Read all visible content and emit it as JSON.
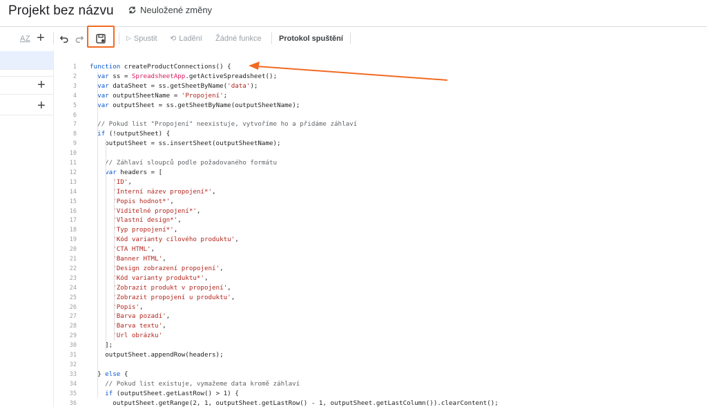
{
  "header": {
    "project_title": "Projekt bez názvu",
    "save_status": "Neuložené změny"
  },
  "toolbar": {
    "sort_label": "AZ",
    "run_label": "Spustit",
    "debug_label": "Ladění",
    "functions_label": "Žádné funkce",
    "execution_log_label": "Protokol spuštění",
    "accent_color": "#f26a21"
  },
  "editor": {
    "line_numbers": [
      "1",
      "2",
      "3",
      "4",
      "5",
      "6",
      "7",
      "8",
      "9",
      "10",
      "11",
      "12",
      "13",
      "14",
      "15",
      "16",
      "17",
      "18",
      "19",
      "20",
      "21",
      "22",
      "23",
      "24",
      "25",
      "26",
      "27",
      "28",
      "29",
      "30",
      "31",
      "32",
      "33",
      "34",
      "35",
      "36"
    ],
    "lines": [
      "function createProductConnections() {",
      "  var ss = SpreadsheetApp.getActiveSpreadsheet();",
      "  var dataSheet = ss.getSheetByName('data');",
      "  var outputSheetName = 'Propojení';",
      "  var outputSheet = ss.getSheetByName(outputSheetName);",
      "",
      "  // Pokud list \"Propojení\" neexistuje, vytvoříme ho a přidáme záhlaví",
      "  if (!outputSheet) {",
      "    outputSheet = ss.insertSheet(outputSheetName);",
      "",
      "    // Záhlaví sloupců podle požadovaného formátu",
      "    var headers = [",
      "      'ID',",
      "      'Interní název propojení*',",
      "      'Popis hodnot*',",
      "      'Viditelné propojení*',",
      "      'Vlastní design*',",
      "      'Typ propojení*',",
      "      'Kód varianty cílového produktu',",
      "      'CTA HTML',",
      "      'Banner HTML',",
      "      'Design zobrazení propojení',",
      "      'Kód varianty produktu*',",
      "      'Zobrazit produkt v propojení',",
      "      'Zobrazit propojení u produktu',",
      "      'Popis',",
      "      'Barva pozadí',",
      "      'Barva textu',",
      "      'Url obrázku'",
      "    ];",
      "    outputSheet.appendRow(headers);",
      "",
      "  } else {",
      "    // Pokud list existuje, vymažeme data kromě záhlaví",
      "    if (outputSheet.getLastRow() > 1) {",
      "      outputSheet.getRange(2, 1, outputSheet.getLastRow() - 1, outputSheet.getLastColumn()).clearContent();"
    ]
  }
}
